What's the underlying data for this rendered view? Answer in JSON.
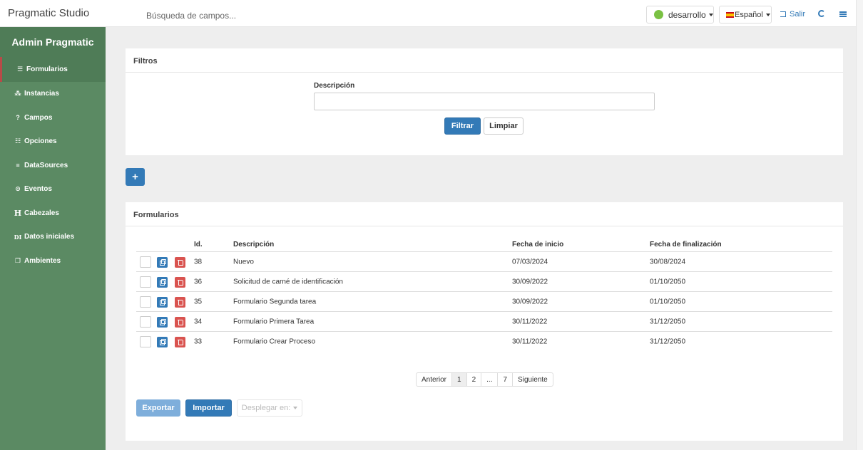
{
  "app": {
    "brand": "Pragmatic Studio",
    "search_placeholder": "Búsqueda de campos...",
    "environment": "desarrollo",
    "language": "Español",
    "logout": "Salir",
    "colors": {
      "accent": "#337ab7",
      "sidebar": "#5b8a63",
      "danger": "#d9534f",
      "env_dot": "#7ac143"
    }
  },
  "sidebar": {
    "title": "Admin Pragmatic",
    "items": [
      {
        "icon": "list-icon",
        "label": "Formularios"
      },
      {
        "icon": "sitemap-icon",
        "label": "Instancias"
      },
      {
        "icon": "question-icon",
        "label": "Campos"
      },
      {
        "icon": "list-ul-icon",
        "label": "Opciones"
      },
      {
        "icon": "database-icon",
        "label": "DataSources"
      },
      {
        "icon": "clock-icon",
        "label": "Eventos"
      },
      {
        "icon": "header-icon",
        "label": "Cabezales"
      },
      {
        "icon": "di-icon",
        "label": "Datos iniciales"
      },
      {
        "icon": "clone-icon",
        "label": "Ambientes"
      }
    ]
  },
  "filters": {
    "title": "Filtros",
    "description_label": "Descripción",
    "filter_button": "Filtrar",
    "clear_button": "Limpiar"
  },
  "forms": {
    "title": "Formularios",
    "add_button": "+",
    "columns": [
      "Id.",
      "Descripción",
      "Fecha de inicio",
      "Fecha de finalización"
    ],
    "rows": [
      {
        "id": "38",
        "description": "Nuevo",
        "start": "07/03/2024",
        "end": "30/08/2024"
      },
      {
        "id": "36",
        "description": "Solicitud de carné de identificación",
        "start": "30/09/2022",
        "end": "01/10/2050"
      },
      {
        "id": "35",
        "description": "Formulario Segunda tarea",
        "start": "30/09/2022",
        "end": "01/10/2050"
      },
      {
        "id": "34",
        "description": "Formulario Primera Tarea",
        "start": "30/11/2022",
        "end": "31/12/2050"
      },
      {
        "id": "33",
        "description": "Formulario Crear Proceso",
        "start": "30/11/2022",
        "end": "31/12/2050"
      }
    ],
    "pagination": [
      "Anterior",
      "1",
      "2",
      "...",
      "7",
      "Siguiente"
    ],
    "pagination_active": "1",
    "export_button": "Exportar",
    "import_button": "Importar",
    "deploy_dropdown": "Desplegar en:"
  }
}
